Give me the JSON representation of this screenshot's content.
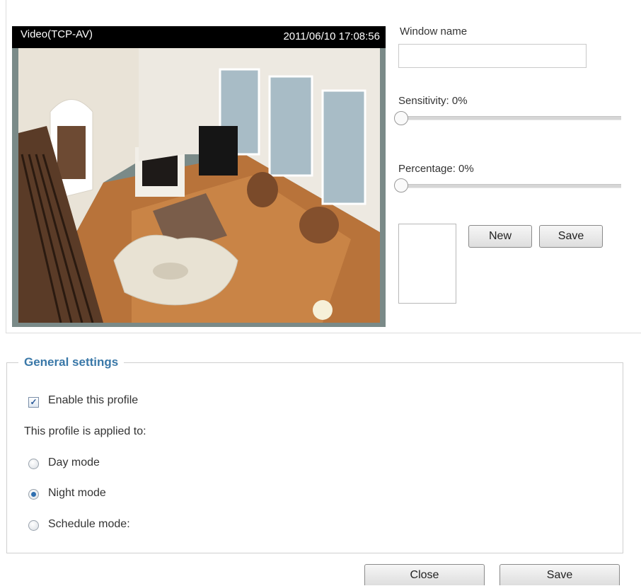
{
  "video": {
    "title": "Video(TCP-AV)",
    "timestamp": "2011/06/10  17:08:56"
  },
  "motion_window": {
    "window_name_label": "Window name",
    "window_name_value": "",
    "sensitivity_label": "Sensitivity: 0%",
    "sensitivity_value": 0,
    "percentage_label": "Percentage: 0%",
    "percentage_value": 0,
    "new_button": "New",
    "save_button": "Save"
  },
  "general_settings": {
    "legend": "General settings",
    "enable_profile_label": "Enable this profile",
    "enable_profile_checked": true,
    "applied_to_label": "This profile is applied to:",
    "modes": [
      {
        "label": "Day mode",
        "selected": false
      },
      {
        "label": "Night mode",
        "selected": true
      },
      {
        "label": "Schedule mode:",
        "selected": false
      }
    ]
  },
  "footer": {
    "close_button": "Close",
    "save_button": "Save"
  },
  "colors": {
    "legend_text": "#3a78a8",
    "radio_selected": "#2f6fb0",
    "video_bar": "#000000"
  }
}
